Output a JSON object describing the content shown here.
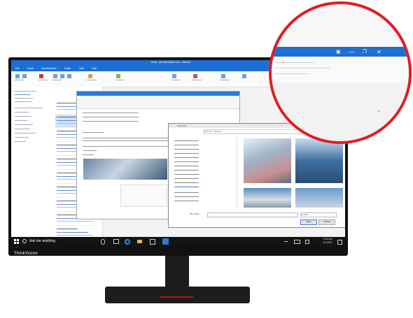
{
  "outlook": {
    "window_title": "Inbox - john@outlook.com - Outlook",
    "menu": [
      "File",
      "Home",
      "Send/Receive",
      "Folder",
      "View",
      "Help"
    ]
  },
  "file_dialog": {
    "title": "Insert File",
    "path": "This PC > Pictures",
    "file_name_label": "File name:",
    "file_type": "All Files",
    "open_label": "Open",
    "cancel_label": "Cancel"
  },
  "taskbar": {
    "search_placeholder": "Ask me anything",
    "time": "9:30 AM",
    "date": "1/1/2019"
  },
  "monitor": {
    "brand": "ThinkVision"
  },
  "zoom": {
    "restore_icon": "restore-icon",
    "minimize_icon": "minimize-icon",
    "maximize_icon": "maximize-icon",
    "close_icon": "close-icon",
    "expand_icon": "chevron-icon"
  },
  "colors": {
    "accent": "#1e6fd1",
    "callout": "#e21b23",
    "taskbar": "#141414"
  }
}
